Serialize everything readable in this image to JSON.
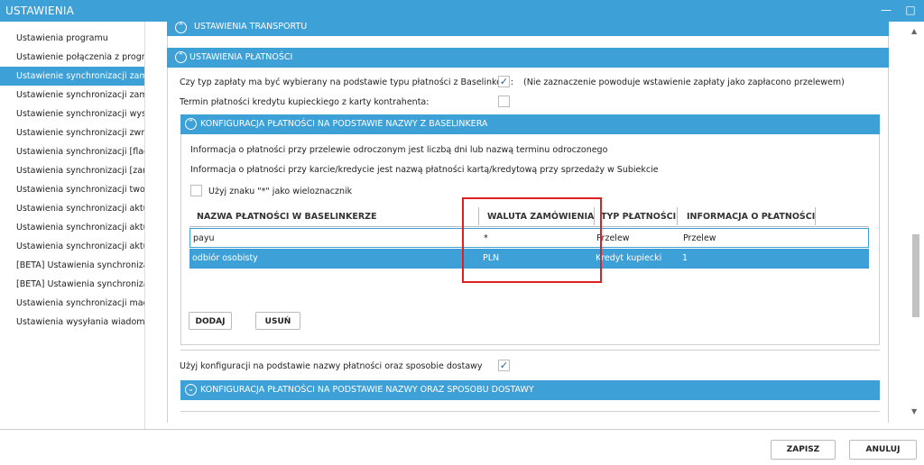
{
  "window": {
    "title": "USTAWIENIA"
  },
  "sidebar": {
    "items": [
      "Ustawienia programu",
      "Ustawienie połączenia z progra",
      "Ustawienie synchronizacji zamó",
      "Ustawienie synchronizacji zamó",
      "Ustawienie synchronizacji wysy",
      "Ustawienie synchronizacji zwro",
      "Ustawienia synchronizacji [flaga",
      "Ustawienia synchronizacji [zamo",
      "Ustawienia synchronizacji twor",
      "Ustawienia synchronizacji aktua",
      "Ustawienia synchronizacji aktua",
      "Ustawienia synchronizacji aktua",
      "[BETA] Ustawienia synchronizac",
      "[BETA] Ustawienia synchronizac",
      "Ustawienia synchronizacji maga",
      "Ustawienia wysyłania wiadomo"
    ],
    "selected_index": 2
  },
  "sections": {
    "transport_header": "USTAWIENIA TRANSPORTU",
    "payment_header": "USTAWIENIA PŁATNOŚCI",
    "q1_label": "Czy typ zapłaty ma być wybierany na podstawie typu płatności z Baselinkera:",
    "q1_note": "(Nie zaznaczenie powoduje wstawienie zapłaty jako zapłacono przelewem)",
    "q2_label": "Termin płatności kredytu kupieckiego z karty kontrahenta:",
    "config_header": "KONFIGURACJA PŁATNOŚCI NA PODSTAWIE NAZWY Z BASELINKERA",
    "info1": "Informacja o płatności przy przelewie odroczonym jest liczbą dni lub nazwą terminu odroczonego",
    "info2": "Informacja o płatności przy karcie/kredycie jest nazwą płatności kartą/kredytową przy sprzedaży w Subiekcie",
    "wildcard_label": "Użyj znaku \"*\" jako wieloznacznik",
    "add_button": "DODAJ",
    "remove_button": "USUŃ",
    "q3_label": "Użyj konfiguracji na podstawie nazwy płatności oraz sposobie dostawy",
    "config2_header": "KONFIGURACJA PŁATNOŚCI NA PODSTAWIE NAZWY ORAZ SPOSOBU DOSTAWY"
  },
  "grid": {
    "columns": [
      "NAZWA PŁATNOŚCI W BASELINKERZE",
      "WALUTA ZAMÓWIENIA",
      "TYP PŁATNOŚCI",
      "INFORMACJA O PŁATNOŚCI"
    ],
    "rows": [
      {
        "name": "payu",
        "currency": "*",
        "type": "Przelew",
        "info": "Przelew",
        "selected": false
      },
      {
        "name": "odbiór osobisty",
        "currency": "PLN",
        "type": "Kredyt kupiecki",
        "info": "1",
        "selected": true
      }
    ]
  },
  "checkboxes": {
    "q1_checked": true,
    "q2_checked": false,
    "wildcard_checked": false,
    "q3_checked": true
  },
  "footer": {
    "save_button": "ZAPISZ",
    "cancel_button": "ANULUJ"
  },
  "colors": {
    "accent": "#3da0d6",
    "highlight": "#e02020"
  }
}
